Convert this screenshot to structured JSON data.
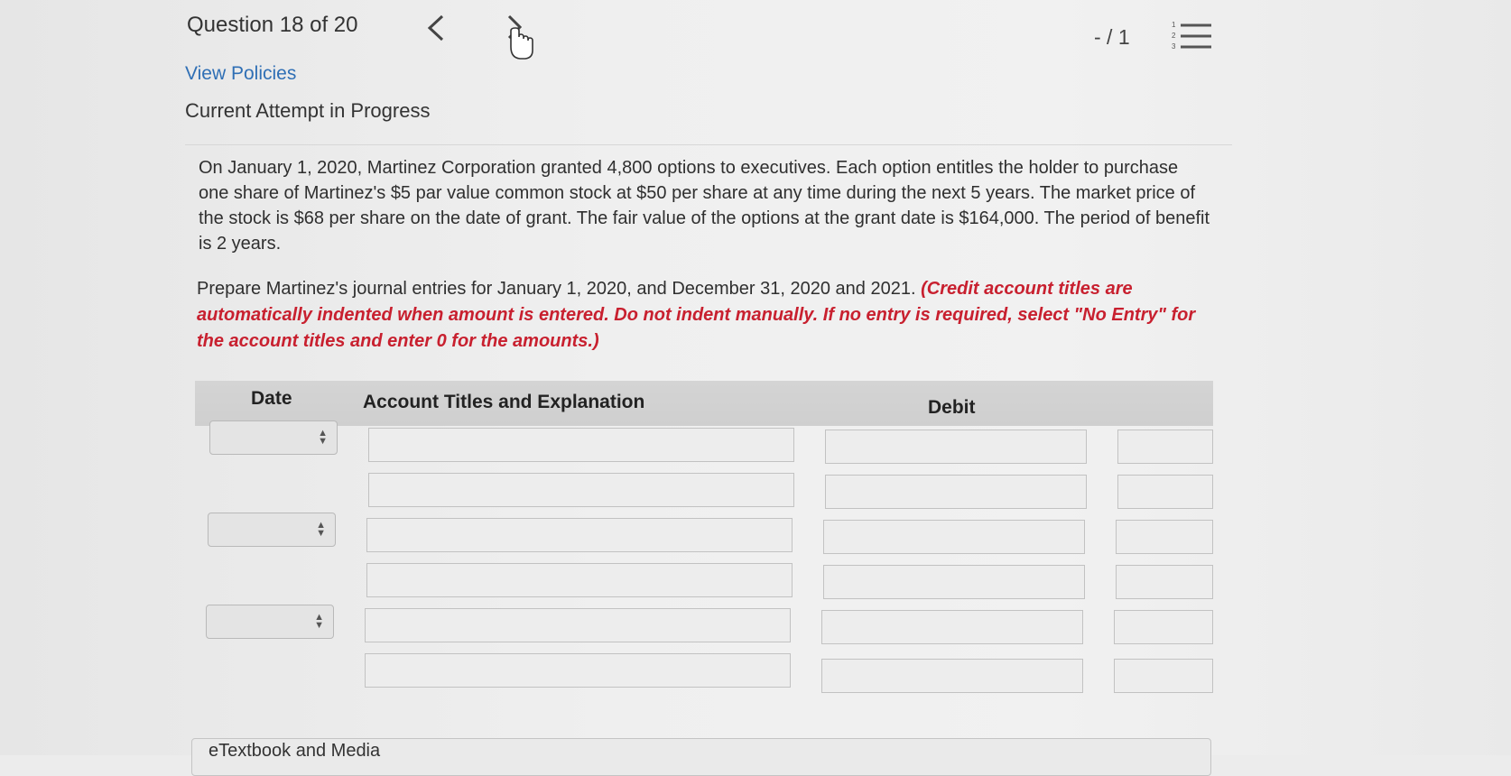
{
  "header": {
    "question_counter": "Question 18 of 20",
    "score": "- / 1",
    "prev_icon": "chevron-left-icon",
    "next_icon": "chevron-right-icon",
    "list_icon": "numbered-list-icon"
  },
  "links": {
    "view_policies": "View Policies"
  },
  "status": {
    "attempt": "Current Attempt in Progress"
  },
  "problem": {
    "text": "On January 1, 2020, Martinez Corporation granted 4,800 options to executives. Each option entitles the holder to purchase one share of Martinez's $5 par value common stock at $50 per share at any time during the next 5 years. The market price of the stock is $68 per share on the date of grant. The fair value of the options at the grant date is $164,000. The period of benefit is 2 years."
  },
  "instructions": {
    "lead": "Prepare Martinez's journal entries for January 1, 2020, and December 31, 2020 and 2021.",
    "note": "(Credit account titles are automatically indented when amount is entered. Do not indent manually. If no entry is required, select \"No Entry\" for the account titles and enter 0 for the amounts.)"
  },
  "table": {
    "headers": {
      "date": "Date",
      "account": "Account Titles and Explanation",
      "debit": "Debit"
    },
    "rows": [
      {
        "date": "",
        "account": "",
        "debit": "",
        "credit": ""
      },
      {
        "date": "",
        "account": "",
        "debit": "",
        "credit": ""
      },
      {
        "date": "",
        "account": "",
        "debit": "",
        "credit": ""
      },
      {
        "date": "",
        "account": "",
        "debit": "",
        "credit": ""
      },
      {
        "date": "",
        "account": "",
        "debit": "",
        "credit": ""
      },
      {
        "date": "",
        "account": "",
        "debit": "",
        "credit": ""
      }
    ]
  },
  "footer": {
    "etextbook": "eTextbook and Media"
  },
  "colors": {
    "link": "#2f6fb5",
    "alert": "#c8202f",
    "header_bg": "#d4d4d4"
  }
}
